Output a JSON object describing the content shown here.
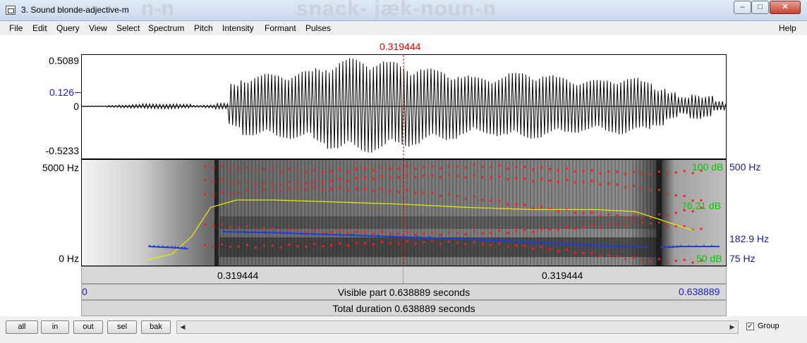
{
  "window": {
    "title": "3. Sound blonde-adjective-m",
    "background_title_fragment_1": "n-n",
    "background_title_fragment_2": "snack- jæk-noun-n",
    "controls": {
      "minimize": "–",
      "maximize": "□",
      "close": "✕"
    }
  },
  "menu": {
    "items": [
      "File",
      "Edit",
      "Query",
      "View",
      "Select",
      "Spectrum",
      "Pitch",
      "Intensity",
      "Formant",
      "Pulses"
    ],
    "help": "Help"
  },
  "cursor": {
    "time_label": "0.319444",
    "color": "#e00000"
  },
  "waveform": {
    "y_max": "0.5089",
    "y_mark": "0.126",
    "y_zero": "0",
    "y_min": "-0.5233",
    "amplitude_envelope": [
      0.01,
      0.01,
      0.02,
      0.03,
      0.04,
      0.05,
      0.05,
      0.05,
      0.04,
      0.02,
      0.03,
      0.06,
      0.45,
      0.6,
      0.62,
      0.64,
      0.66,
      0.68,
      0.7,
      0.78,
      0.88,
      0.92,
      0.95,
      0.96,
      0.92,
      0.88,
      0.84,
      0.8,
      0.75,
      0.72,
      0.68,
      0.62,
      0.58,
      0.58,
      0.62,
      0.66,
      0.68,
      0.66,
      0.62,
      0.58,
      0.55,
      0.52,
      0.52,
      0.55,
      0.58,
      0.56,
      0.5,
      0.4,
      0.28,
      0.18,
      0.26,
      0.22,
      0.1,
      0.05
    ]
  },
  "spectrogram": {
    "freq_top": "5000 Hz",
    "freq_bottom": "0 Hz",
    "intensity_top": "100 dB",
    "intensity_mid": "76.21 dB",
    "intensity_bottom": "50 dB",
    "pitch_top": "500 Hz",
    "pitch_mark": "182.9 Hz",
    "pitch_bottom": "75 Hz",
    "colors": {
      "pitch": "#1a3fd6",
      "formant": "#ff1a1a",
      "intensity": "#e8e800",
      "db_label": "#00c800",
      "hz_label": "#1a1aa0"
    },
    "pitch_track": [
      [
        0.105,
        0.18
      ],
      [
        0.14,
        0.17
      ],
      [
        0.165,
        0.16
      ],
      [
        0.22,
        0.32
      ],
      [
        0.3,
        0.31
      ],
      [
        0.4,
        0.29
      ],
      [
        0.5,
        0.27
      ],
      [
        0.6,
        0.25
      ],
      [
        0.7,
        0.22
      ],
      [
        0.8,
        0.19
      ],
      [
        0.88,
        0.17
      ],
      [
        0.9,
        0.17
      ],
      [
        0.93,
        0.18
      ],
      [
        0.99,
        0.18
      ]
    ],
    "intensity_track": [
      [
        0.1,
        0.05
      ],
      [
        0.14,
        0.11
      ],
      [
        0.17,
        0.27
      ],
      [
        0.2,
        0.55
      ],
      [
        0.24,
        0.62
      ],
      [
        0.3,
        0.62
      ],
      [
        0.4,
        0.6
      ],
      [
        0.5,
        0.58
      ],
      [
        0.6,
        0.55
      ],
      [
        0.7,
        0.53
      ],
      [
        0.8,
        0.53
      ],
      [
        0.86,
        0.51
      ],
      [
        0.9,
        0.43
      ],
      [
        0.93,
        0.37
      ],
      [
        0.95,
        0.33
      ]
    ]
  },
  "selection_bar": {
    "left": "0.319444",
    "right": "0.319444"
  },
  "visible_bar": {
    "start": "0",
    "label": "Visible part 0.638889 seconds",
    "end": "0.638889"
  },
  "total_bar": {
    "label": "Total duration 0.638889 seconds"
  },
  "bottom": {
    "buttons": [
      "all",
      "in",
      "out",
      "sel",
      "bak"
    ],
    "scroll_left": "◀",
    "scroll_right": "▶",
    "group_label": "Group",
    "group_checked": "✓"
  }
}
